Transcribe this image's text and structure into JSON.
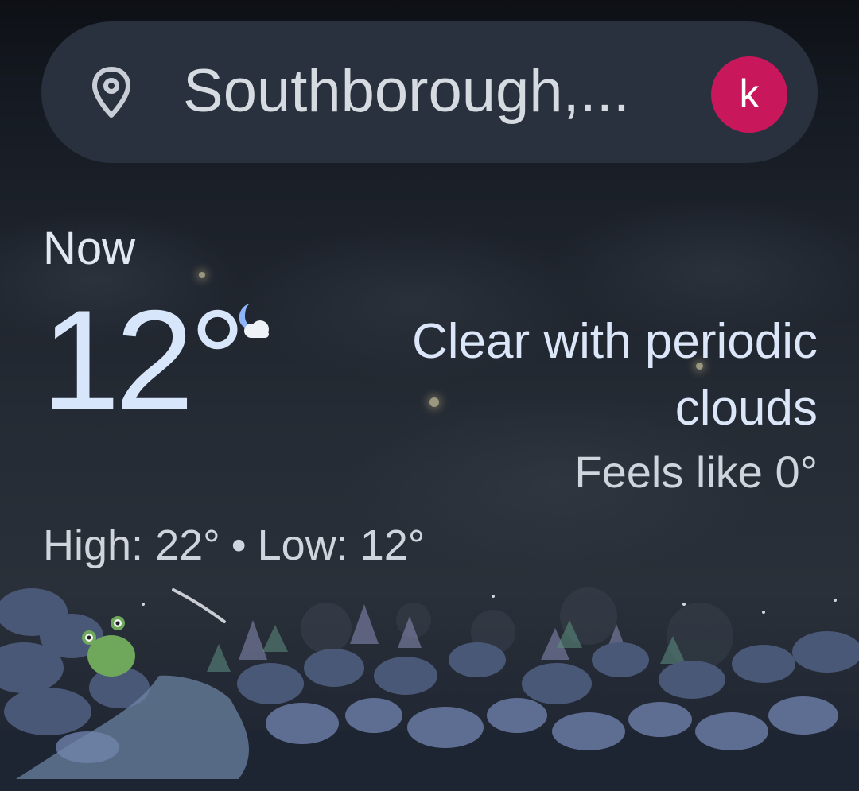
{
  "search_bar": {
    "location": "Southborough,...",
    "location_icon": "map-pin-icon",
    "avatar_initial": "k"
  },
  "current": {
    "label": "Now",
    "temperature": "12°",
    "condition_icon": "moon-cloud-icon",
    "condition": "Clear with periodic clouds",
    "feels_like": "Feels like 0°",
    "high": "High: 22°",
    "separator": "•",
    "low": "Low: 12°"
  },
  "colors": {
    "avatar": "#c8175a",
    "search_bar": "#28313d",
    "temperature": "#d8e6fb",
    "moon": "#8fb4f7"
  }
}
